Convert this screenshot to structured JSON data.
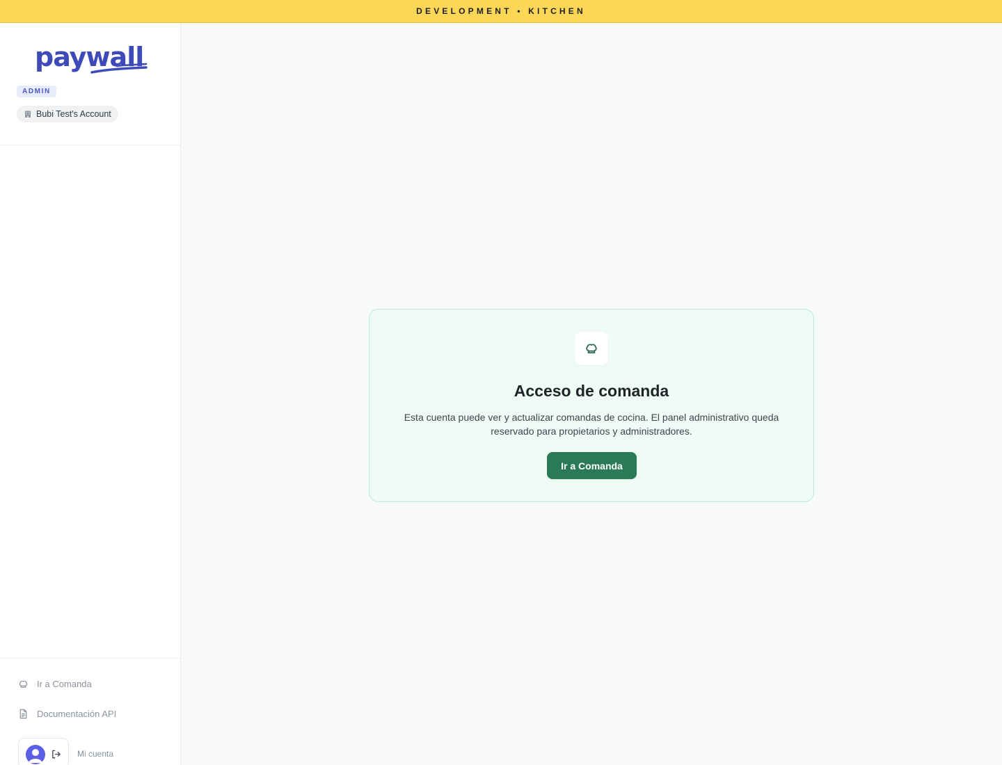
{
  "banner": {
    "text": "DEVELOPMENT • KITCHEN",
    "color": "#fcd757"
  },
  "sidebar": {
    "logo": {
      "text": "paywall",
      "icon": "paywall-logo",
      "color": "#3d4ab8"
    },
    "role_badge": "ADMIN",
    "account": {
      "label": "Bubi Test's Account",
      "icon": "building-icon"
    },
    "footer": {
      "links": [
        {
          "label": "Ir a Comanda",
          "icon": "chef-hat-icon"
        },
        {
          "label": "Documentación API",
          "icon": "document-icon"
        }
      ],
      "user": {
        "avatar_icon": "user-avatar",
        "logout_icon": "logout-icon",
        "label": "Mi cuenta"
      }
    }
  },
  "main": {
    "card": {
      "icon": "chef-hat-icon",
      "title": "Acceso de comanda",
      "description": "Esta cuenta puede ver y actualizar comandas de cocina. El panel administrativo queda reservado para propietarios y administradores.",
      "button_label": "Ir a Comanda",
      "accent_color": "#2b7a57",
      "background_color": "#effcf5"
    }
  }
}
